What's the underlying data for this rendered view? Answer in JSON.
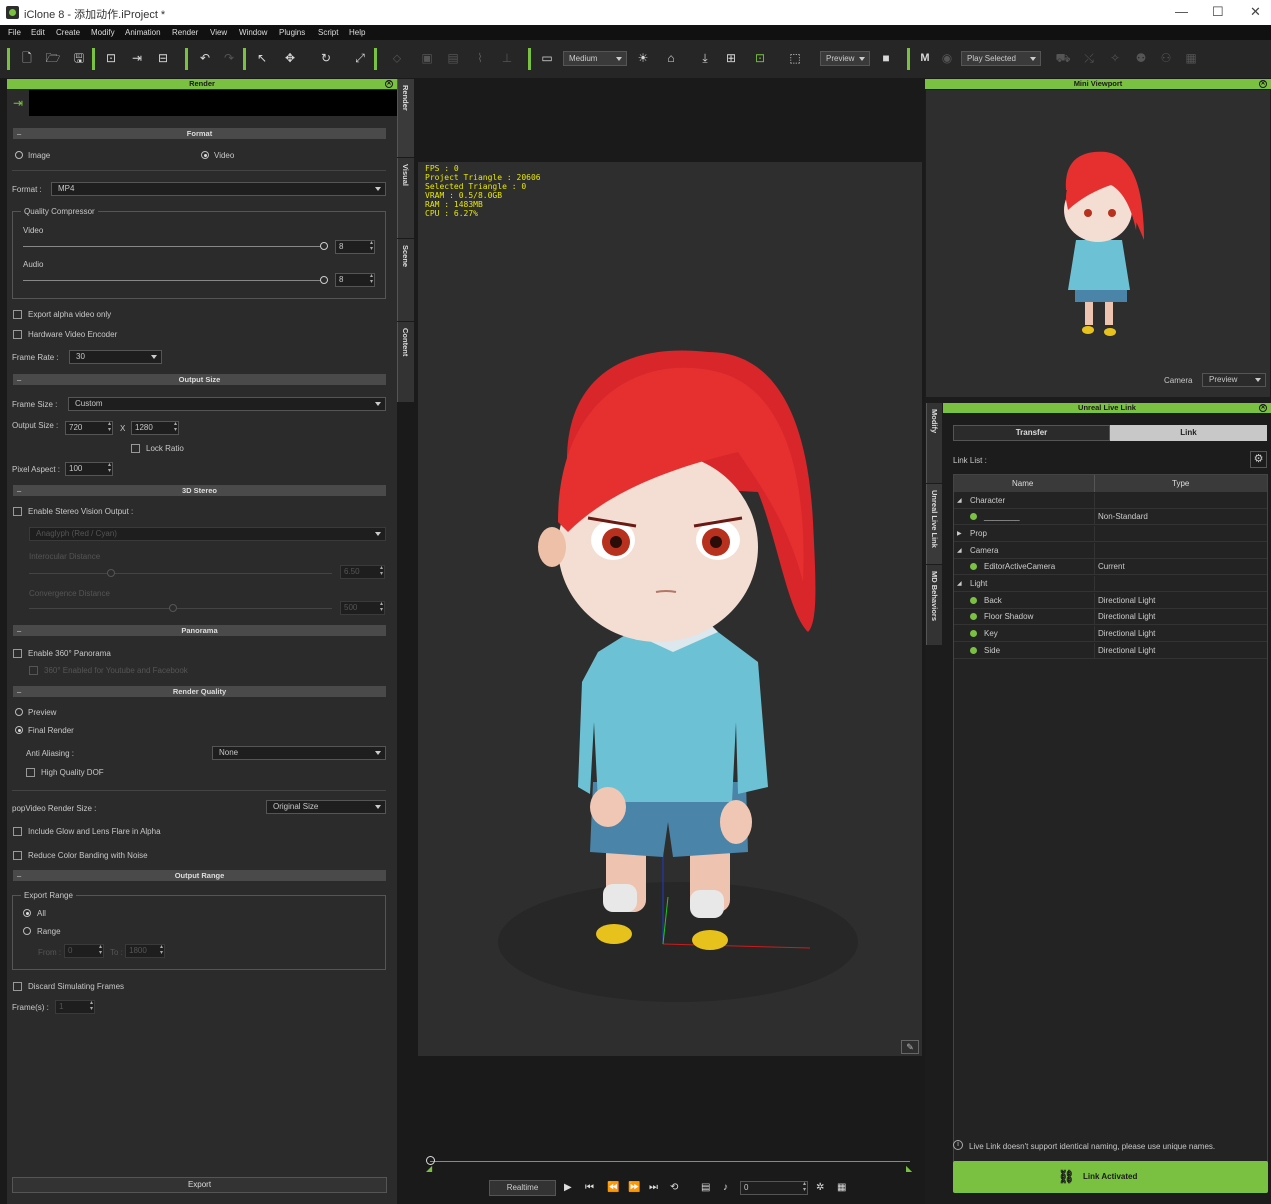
{
  "window": {
    "title": "iClone 8 - 添加动作.iProject *",
    "minimize": "—",
    "maximize": "☐",
    "close": "✕"
  },
  "menu": [
    "File",
    "Edit",
    "Create",
    "Modify",
    "Animation",
    "Render",
    "View",
    "Window",
    "Plugins",
    "Script",
    "Help"
  ],
  "toolbar": {
    "quality": "Medium",
    "preview": "Preview",
    "play_selected": "Play Selected"
  },
  "render_panel": {
    "title": "Render",
    "format_section": "Format",
    "image_label": "Image",
    "video_label": "Video",
    "format_label": "Format :",
    "format_value": "MP4",
    "quality_group": "Quality Compressor",
    "video_q_label": "Video",
    "video_q_value": "8",
    "audio_q_label": "Audio",
    "audio_q_value": "8",
    "export_alpha": "Export alpha video only",
    "hw_encoder": "Hardware Video Encoder",
    "frame_rate_label": "Frame Rate :",
    "frame_rate_value": "30",
    "output_size_section": "Output Size",
    "frame_size_label": "Frame Size :",
    "frame_size_value": "Custom",
    "output_size_label": "Output Size :",
    "width": "720",
    "x": "X",
    "height": "1280",
    "lock_ratio": "Lock Ratio",
    "pixel_aspect_label": "Pixel Aspect :",
    "pixel_aspect_value": "100",
    "stereo_section": "3D Stereo",
    "enable_stereo": "Enable Stereo Vision Output :",
    "anaglyph": "Anaglyph (Red / Cyan)",
    "interocular": "Interocular Distance",
    "interocular_value": "6.50",
    "convergence": "Convergence Distance",
    "convergence_value": "500",
    "panorama_section": "Panorama",
    "enable_panorama": "Enable 360° Panorama",
    "panorama_youtube": "360° Enabled for Youtube and Facebook",
    "quality_section": "Render Quality",
    "preview_label": "Preview",
    "final_render": "Final Render",
    "aa_label": "Anti Aliasing :",
    "aa_value": "None",
    "hq_dof": "High Quality DOF",
    "popvideo_label": "popVideo Render Size :",
    "popvideo_value": "Original Size",
    "glow": "Include Glow and Lens Flare in Alpha",
    "banding": "Reduce Color Banding with Noise",
    "range_section": "Output Range",
    "export_range": "Export Range",
    "all": "All",
    "range": "Range",
    "from_label": "From :",
    "from_value": "0",
    "to_label": "To :",
    "to_value": "1800",
    "discard": "Discard Simulating Frames",
    "frames_label": "Frame(s) :",
    "frames_value": "1",
    "export_button": "Export"
  },
  "side_tabs": [
    "Render",
    "Visual",
    "Scene",
    "Content"
  ],
  "viewport": {
    "info": "FPS : 0\nProject Triangle : 20606\nSelected Triangle : 0\nVRAM : 0.5/8.0GB\nRAM : 1483MB\nCPU : 6.27%"
  },
  "mini_viewport": {
    "title": "Mini Viewport",
    "camera_label": "Camera",
    "camera_value": "Preview"
  },
  "right_tabs": [
    "Modify",
    "Unreal Live Link",
    "MD Behaviors"
  ],
  "live_link": {
    "title": "Unreal Live Link",
    "tab_transfer": "Transfer",
    "tab_link": "Link",
    "link_list": "Link List :",
    "col_name": "Name",
    "col_type": "Type",
    "rows": [
      {
        "name": "Character",
        "type": "",
        "kind": "group"
      },
      {
        "name": "________",
        "type": "Non-Standard",
        "kind": "item"
      },
      {
        "name": "Prop",
        "type": "",
        "kind": "group-collapsed"
      },
      {
        "name": "Camera",
        "type": "",
        "kind": "group"
      },
      {
        "name": "EditorActiveCamera",
        "type": "Current",
        "kind": "item"
      },
      {
        "name": "Light",
        "type": "",
        "kind": "group"
      },
      {
        "name": "Back",
        "type": "Directional Light",
        "kind": "item"
      },
      {
        "name": "Floor Shadow",
        "type": "Directional Light",
        "kind": "item"
      },
      {
        "name": "Key",
        "type": "Directional Light",
        "kind": "item"
      },
      {
        "name": "Side",
        "type": "Directional Light",
        "kind": "item"
      }
    ],
    "note": "Live Link doesn't support identical naming, please use unique names.",
    "activate_button": "Link Activated"
  },
  "timeline": {
    "realtime": "Realtime",
    "frame_value": "0"
  },
  "colors": {
    "accent": "#7ac141"
  }
}
